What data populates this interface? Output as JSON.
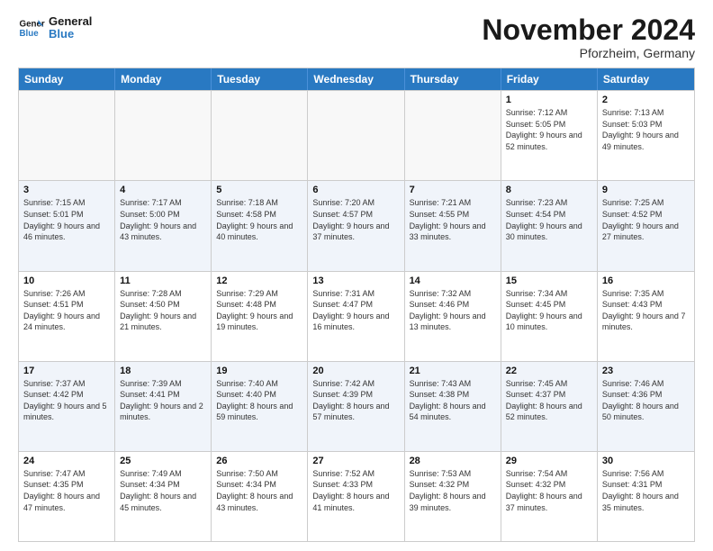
{
  "logo": {
    "line1": "General",
    "line2": "Blue"
  },
  "title": "November 2024",
  "location": "Pforzheim, Germany",
  "days": [
    "Sunday",
    "Monday",
    "Tuesday",
    "Wednesday",
    "Thursday",
    "Friday",
    "Saturday"
  ],
  "rows": [
    [
      {
        "day": "",
        "text": ""
      },
      {
        "day": "",
        "text": ""
      },
      {
        "day": "",
        "text": ""
      },
      {
        "day": "",
        "text": ""
      },
      {
        "day": "",
        "text": ""
      },
      {
        "day": "1",
        "text": "Sunrise: 7:12 AM\nSunset: 5:05 PM\nDaylight: 9 hours and 52 minutes."
      },
      {
        "day": "2",
        "text": "Sunrise: 7:13 AM\nSunset: 5:03 PM\nDaylight: 9 hours and 49 minutes."
      }
    ],
    [
      {
        "day": "3",
        "text": "Sunrise: 7:15 AM\nSunset: 5:01 PM\nDaylight: 9 hours and 46 minutes."
      },
      {
        "day": "4",
        "text": "Sunrise: 7:17 AM\nSunset: 5:00 PM\nDaylight: 9 hours and 43 minutes."
      },
      {
        "day": "5",
        "text": "Sunrise: 7:18 AM\nSunset: 4:58 PM\nDaylight: 9 hours and 40 minutes."
      },
      {
        "day": "6",
        "text": "Sunrise: 7:20 AM\nSunset: 4:57 PM\nDaylight: 9 hours and 37 minutes."
      },
      {
        "day": "7",
        "text": "Sunrise: 7:21 AM\nSunset: 4:55 PM\nDaylight: 9 hours and 33 minutes."
      },
      {
        "day": "8",
        "text": "Sunrise: 7:23 AM\nSunset: 4:54 PM\nDaylight: 9 hours and 30 minutes."
      },
      {
        "day": "9",
        "text": "Sunrise: 7:25 AM\nSunset: 4:52 PM\nDaylight: 9 hours and 27 minutes."
      }
    ],
    [
      {
        "day": "10",
        "text": "Sunrise: 7:26 AM\nSunset: 4:51 PM\nDaylight: 9 hours and 24 minutes."
      },
      {
        "day": "11",
        "text": "Sunrise: 7:28 AM\nSunset: 4:50 PM\nDaylight: 9 hours and 21 minutes."
      },
      {
        "day": "12",
        "text": "Sunrise: 7:29 AM\nSunset: 4:48 PM\nDaylight: 9 hours and 19 minutes."
      },
      {
        "day": "13",
        "text": "Sunrise: 7:31 AM\nSunset: 4:47 PM\nDaylight: 9 hours and 16 minutes."
      },
      {
        "day": "14",
        "text": "Sunrise: 7:32 AM\nSunset: 4:46 PM\nDaylight: 9 hours and 13 minutes."
      },
      {
        "day": "15",
        "text": "Sunrise: 7:34 AM\nSunset: 4:45 PM\nDaylight: 9 hours and 10 minutes."
      },
      {
        "day": "16",
        "text": "Sunrise: 7:35 AM\nSunset: 4:43 PM\nDaylight: 9 hours and 7 minutes."
      }
    ],
    [
      {
        "day": "17",
        "text": "Sunrise: 7:37 AM\nSunset: 4:42 PM\nDaylight: 9 hours and 5 minutes."
      },
      {
        "day": "18",
        "text": "Sunrise: 7:39 AM\nSunset: 4:41 PM\nDaylight: 9 hours and 2 minutes."
      },
      {
        "day": "19",
        "text": "Sunrise: 7:40 AM\nSunset: 4:40 PM\nDaylight: 8 hours and 59 minutes."
      },
      {
        "day": "20",
        "text": "Sunrise: 7:42 AM\nSunset: 4:39 PM\nDaylight: 8 hours and 57 minutes."
      },
      {
        "day": "21",
        "text": "Sunrise: 7:43 AM\nSunset: 4:38 PM\nDaylight: 8 hours and 54 minutes."
      },
      {
        "day": "22",
        "text": "Sunrise: 7:45 AM\nSunset: 4:37 PM\nDaylight: 8 hours and 52 minutes."
      },
      {
        "day": "23",
        "text": "Sunrise: 7:46 AM\nSunset: 4:36 PM\nDaylight: 8 hours and 50 minutes."
      }
    ],
    [
      {
        "day": "24",
        "text": "Sunrise: 7:47 AM\nSunset: 4:35 PM\nDaylight: 8 hours and 47 minutes."
      },
      {
        "day": "25",
        "text": "Sunrise: 7:49 AM\nSunset: 4:34 PM\nDaylight: 8 hours and 45 minutes."
      },
      {
        "day": "26",
        "text": "Sunrise: 7:50 AM\nSunset: 4:34 PM\nDaylight: 8 hours and 43 minutes."
      },
      {
        "day": "27",
        "text": "Sunrise: 7:52 AM\nSunset: 4:33 PM\nDaylight: 8 hours and 41 minutes."
      },
      {
        "day": "28",
        "text": "Sunrise: 7:53 AM\nSunset: 4:32 PM\nDaylight: 8 hours and 39 minutes."
      },
      {
        "day": "29",
        "text": "Sunrise: 7:54 AM\nSunset: 4:32 PM\nDaylight: 8 hours and 37 minutes."
      },
      {
        "day": "30",
        "text": "Sunrise: 7:56 AM\nSunset: 4:31 PM\nDaylight: 8 hours and 35 minutes."
      }
    ]
  ]
}
